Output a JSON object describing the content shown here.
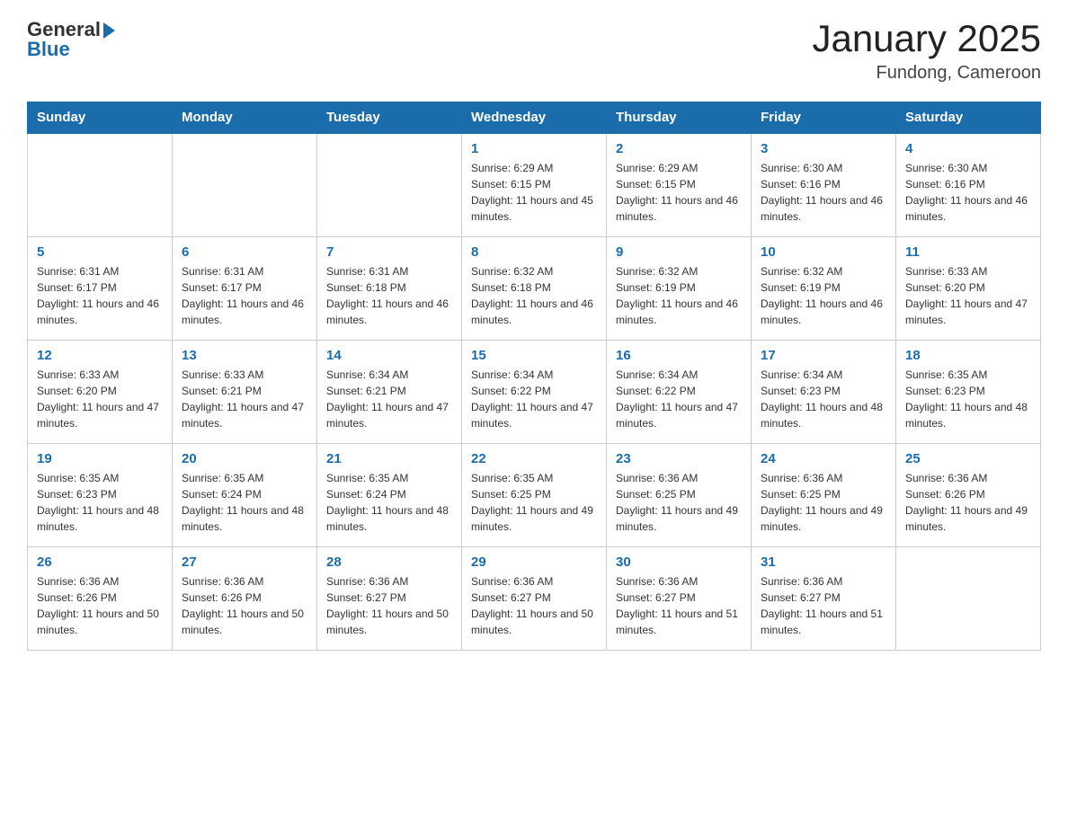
{
  "header": {
    "logo_general": "General",
    "logo_blue": "Blue",
    "title": "January 2025",
    "subtitle": "Fundong, Cameroon"
  },
  "days_of_week": [
    "Sunday",
    "Monday",
    "Tuesday",
    "Wednesday",
    "Thursday",
    "Friday",
    "Saturday"
  ],
  "weeks": [
    [
      {
        "num": "",
        "info": ""
      },
      {
        "num": "",
        "info": ""
      },
      {
        "num": "",
        "info": ""
      },
      {
        "num": "1",
        "info": "Sunrise: 6:29 AM\nSunset: 6:15 PM\nDaylight: 11 hours and 45 minutes."
      },
      {
        "num": "2",
        "info": "Sunrise: 6:29 AM\nSunset: 6:15 PM\nDaylight: 11 hours and 46 minutes."
      },
      {
        "num": "3",
        "info": "Sunrise: 6:30 AM\nSunset: 6:16 PM\nDaylight: 11 hours and 46 minutes."
      },
      {
        "num": "4",
        "info": "Sunrise: 6:30 AM\nSunset: 6:16 PM\nDaylight: 11 hours and 46 minutes."
      }
    ],
    [
      {
        "num": "5",
        "info": "Sunrise: 6:31 AM\nSunset: 6:17 PM\nDaylight: 11 hours and 46 minutes."
      },
      {
        "num": "6",
        "info": "Sunrise: 6:31 AM\nSunset: 6:17 PM\nDaylight: 11 hours and 46 minutes."
      },
      {
        "num": "7",
        "info": "Sunrise: 6:31 AM\nSunset: 6:18 PM\nDaylight: 11 hours and 46 minutes."
      },
      {
        "num": "8",
        "info": "Sunrise: 6:32 AM\nSunset: 6:18 PM\nDaylight: 11 hours and 46 minutes."
      },
      {
        "num": "9",
        "info": "Sunrise: 6:32 AM\nSunset: 6:19 PM\nDaylight: 11 hours and 46 minutes."
      },
      {
        "num": "10",
        "info": "Sunrise: 6:32 AM\nSunset: 6:19 PM\nDaylight: 11 hours and 46 minutes."
      },
      {
        "num": "11",
        "info": "Sunrise: 6:33 AM\nSunset: 6:20 PM\nDaylight: 11 hours and 47 minutes."
      }
    ],
    [
      {
        "num": "12",
        "info": "Sunrise: 6:33 AM\nSunset: 6:20 PM\nDaylight: 11 hours and 47 minutes."
      },
      {
        "num": "13",
        "info": "Sunrise: 6:33 AM\nSunset: 6:21 PM\nDaylight: 11 hours and 47 minutes."
      },
      {
        "num": "14",
        "info": "Sunrise: 6:34 AM\nSunset: 6:21 PM\nDaylight: 11 hours and 47 minutes."
      },
      {
        "num": "15",
        "info": "Sunrise: 6:34 AM\nSunset: 6:22 PM\nDaylight: 11 hours and 47 minutes."
      },
      {
        "num": "16",
        "info": "Sunrise: 6:34 AM\nSunset: 6:22 PM\nDaylight: 11 hours and 47 minutes."
      },
      {
        "num": "17",
        "info": "Sunrise: 6:34 AM\nSunset: 6:23 PM\nDaylight: 11 hours and 48 minutes."
      },
      {
        "num": "18",
        "info": "Sunrise: 6:35 AM\nSunset: 6:23 PM\nDaylight: 11 hours and 48 minutes."
      }
    ],
    [
      {
        "num": "19",
        "info": "Sunrise: 6:35 AM\nSunset: 6:23 PM\nDaylight: 11 hours and 48 minutes."
      },
      {
        "num": "20",
        "info": "Sunrise: 6:35 AM\nSunset: 6:24 PM\nDaylight: 11 hours and 48 minutes."
      },
      {
        "num": "21",
        "info": "Sunrise: 6:35 AM\nSunset: 6:24 PM\nDaylight: 11 hours and 48 minutes."
      },
      {
        "num": "22",
        "info": "Sunrise: 6:35 AM\nSunset: 6:25 PM\nDaylight: 11 hours and 49 minutes."
      },
      {
        "num": "23",
        "info": "Sunrise: 6:36 AM\nSunset: 6:25 PM\nDaylight: 11 hours and 49 minutes."
      },
      {
        "num": "24",
        "info": "Sunrise: 6:36 AM\nSunset: 6:25 PM\nDaylight: 11 hours and 49 minutes."
      },
      {
        "num": "25",
        "info": "Sunrise: 6:36 AM\nSunset: 6:26 PM\nDaylight: 11 hours and 49 minutes."
      }
    ],
    [
      {
        "num": "26",
        "info": "Sunrise: 6:36 AM\nSunset: 6:26 PM\nDaylight: 11 hours and 50 minutes."
      },
      {
        "num": "27",
        "info": "Sunrise: 6:36 AM\nSunset: 6:26 PM\nDaylight: 11 hours and 50 minutes."
      },
      {
        "num": "28",
        "info": "Sunrise: 6:36 AM\nSunset: 6:27 PM\nDaylight: 11 hours and 50 minutes."
      },
      {
        "num": "29",
        "info": "Sunrise: 6:36 AM\nSunset: 6:27 PM\nDaylight: 11 hours and 50 minutes."
      },
      {
        "num": "30",
        "info": "Sunrise: 6:36 AM\nSunset: 6:27 PM\nDaylight: 11 hours and 51 minutes."
      },
      {
        "num": "31",
        "info": "Sunrise: 6:36 AM\nSunset: 6:27 PM\nDaylight: 11 hours and 51 minutes."
      },
      {
        "num": "",
        "info": ""
      }
    ]
  ]
}
